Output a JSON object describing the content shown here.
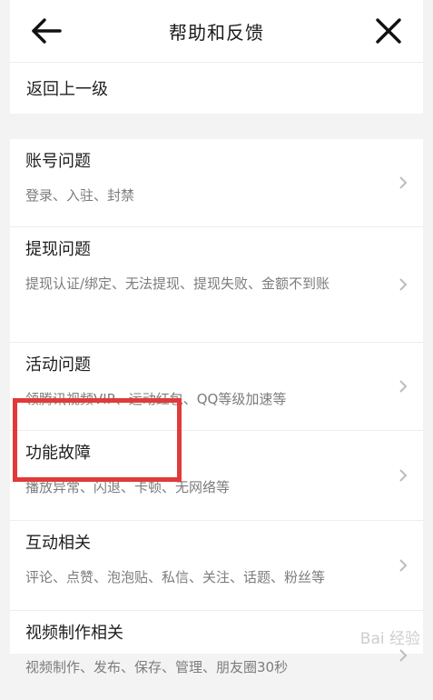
{
  "header": {
    "title": "帮助和反馈",
    "back_icon": "arrow-left-icon",
    "close_icon": "close-icon"
  },
  "back_row": {
    "label": "返回上一级"
  },
  "items": [
    {
      "title": "账号问题",
      "subtitle": "登录、入驻、封禁"
    },
    {
      "title": "提现问题",
      "subtitle": "提现认证/绑定、无法提现、提现失败、金额不到账"
    },
    {
      "title": "活动问题",
      "subtitle": "领腾讯视频VIP、运动红包、QQ等级加速等"
    },
    {
      "title": "功能故障",
      "subtitle": "播放异常、闪退、卡顿、无网络等"
    },
    {
      "title": "互动相关",
      "subtitle": "评论、点赞、泡泡贴、私信、关注、话题、粉丝等"
    },
    {
      "title": "视频制作相关",
      "subtitle": "视频制作、发布、保存、管理、朋友圈30秒"
    }
  ],
  "watermark": "Bai 经验",
  "colors": {
    "highlight": "#e23a3a",
    "subtitle": "#7c7c7c",
    "gap": "#f3f3f3"
  }
}
